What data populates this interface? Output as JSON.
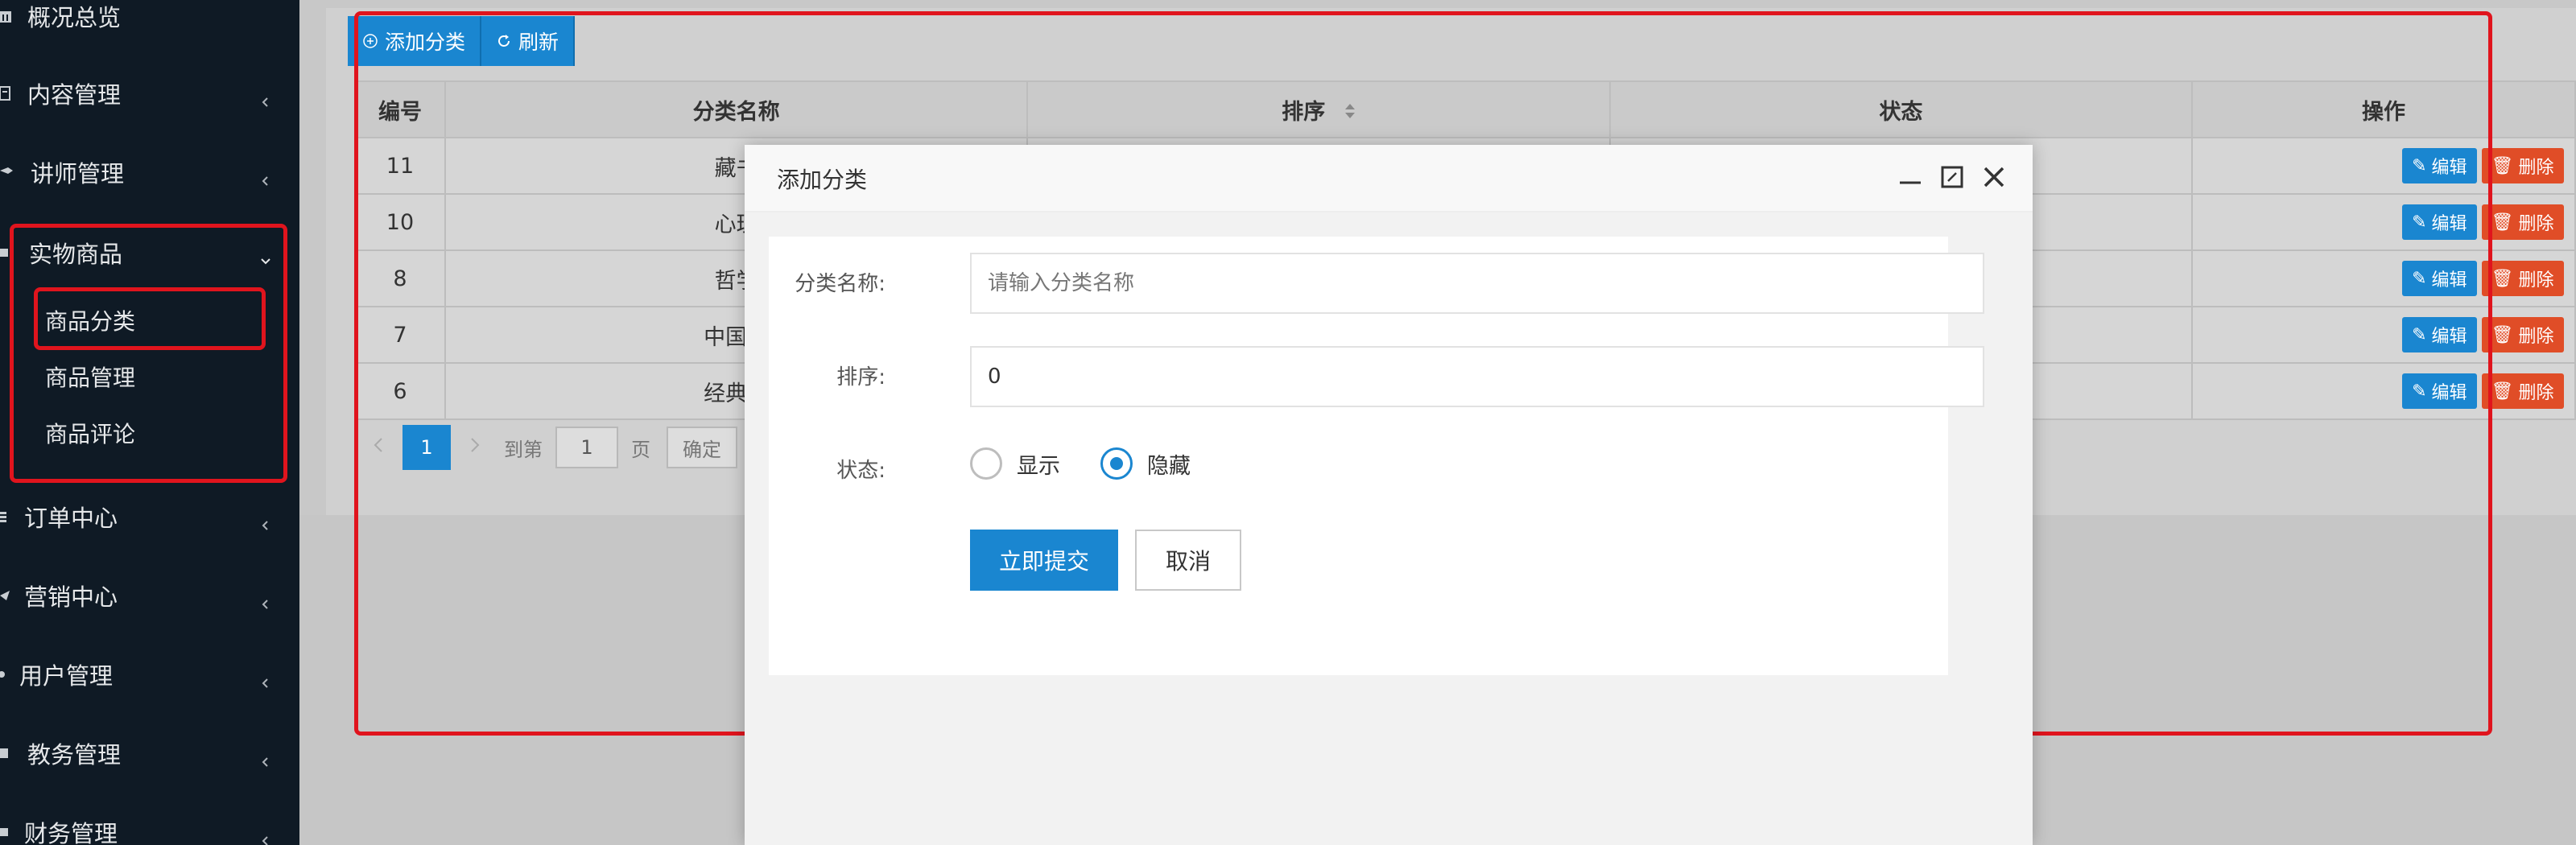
{
  "sidebar": {
    "items": [
      {
        "label": "概况总览",
        "icon": "bank-icon"
      },
      {
        "label": "内容管理",
        "icon": "document-icon"
      },
      {
        "label": "讲师管理",
        "icon": "graduation-cap-icon"
      },
      {
        "label": "实物商品",
        "icon": "box-icon"
      },
      {
        "label": "订单中心",
        "icon": "list-icon"
      },
      {
        "label": "营销中心",
        "icon": "send-icon"
      },
      {
        "label": "用户管理",
        "icon": "user-icon"
      },
      {
        "label": "教务管理",
        "icon": "book-icon"
      },
      {
        "label": "财务管理",
        "icon": "money-icon"
      }
    ],
    "sub_items": [
      "商品分类",
      "商品管理",
      "商品评论"
    ]
  },
  "toolbar": {
    "add_label": "添加分类",
    "refresh_label": "刷新"
  },
  "table": {
    "headers": [
      "编号",
      "分类名称",
      "排序",
      "状态",
      "操作"
    ],
    "rows": [
      {
        "id": "11",
        "name": "藏书"
      },
      {
        "id": "10",
        "name": "心理"
      },
      {
        "id": "8",
        "name": "哲学"
      },
      {
        "id": "7",
        "name": "中国文"
      },
      {
        "id": "6",
        "name": "经典著"
      }
    ],
    "edit_label": "编辑",
    "delete_label": "删除"
  },
  "pager": {
    "current": "1",
    "goto_label": "到第",
    "page_value": "1",
    "page_label": "页",
    "confirm_label": "确定"
  },
  "modal": {
    "title": "添加分类",
    "name_label": "分类名称:",
    "name_placeholder": "请输入分类名称",
    "sort_label": "排序:",
    "sort_value": "0",
    "status_label": "状态:",
    "status_show": "显示",
    "status_hide": "隐藏",
    "submit_label": "立即提交",
    "cancel_label": "取消"
  },
  "colors": {
    "primary": "#1a86d0",
    "danger": "#e04d27",
    "highlight": "#e0141d",
    "sidebar": "#0f1a25"
  }
}
